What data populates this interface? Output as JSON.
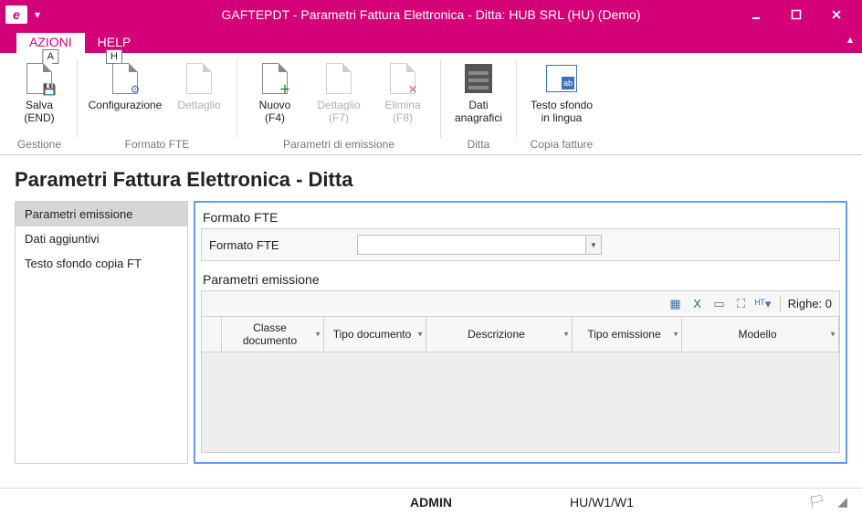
{
  "window": {
    "title": "GAFTEPDT - Parametri Fattura Elettronica - Ditta: HUB SRL (HU)  (Demo)"
  },
  "tabs": {
    "azioni": {
      "label": "AZIONI",
      "shortcut": "A"
    },
    "help": {
      "label": "HELP",
      "shortcut": "H"
    }
  },
  "ribbon": {
    "gestione": {
      "title": "Gestione",
      "salva": {
        "line1": "Salva",
        "line2": "(END)"
      }
    },
    "formato_fte": {
      "title": "Formato FTE",
      "configurazione": {
        "line1": "Configurazione"
      },
      "dettaglio": {
        "line1": "Dettaglio"
      }
    },
    "param_emissione": {
      "title": "Parametri di emissione",
      "nuovo": {
        "line1": "Nuovo",
        "line2": "(F4)"
      },
      "dettaglio": {
        "line1": "Dettaglio",
        "line2": "(F7)"
      },
      "elimina": {
        "line1": "Elimina",
        "line2": "(F8)"
      }
    },
    "ditta": {
      "title": "Ditta",
      "dati_anagrafici": {
        "line1": "Dati",
        "line2": "anagrafici"
      }
    },
    "copia_fatture": {
      "title": "Copia fatture",
      "testo_sfondo": {
        "line1": "Testo sfondo",
        "line2": "in lingua"
      }
    }
  },
  "page_title": "Parametri Fattura Elettronica - Ditta",
  "sidebar": {
    "items": [
      {
        "label": "Parametri emissione"
      },
      {
        "label": "Dati aggiuntivi"
      },
      {
        "label": "Testo sfondo copia FT"
      }
    ]
  },
  "panel_formato": {
    "title": "Formato FTE",
    "field_label": "Formato FTE",
    "field_value": ""
  },
  "panel_parametri": {
    "title": "Parametri emissione",
    "rows_label": "Righe: 0",
    "columns": {
      "classe_documento": "Classe documento",
      "tipo_documento": "Tipo documento",
      "descrizione": "Descrizione",
      "tipo_emissione": "Tipo emissione",
      "modello": "Modello"
    }
  },
  "statusbar": {
    "user": "ADMIN",
    "context": "HU/W1/W1"
  }
}
